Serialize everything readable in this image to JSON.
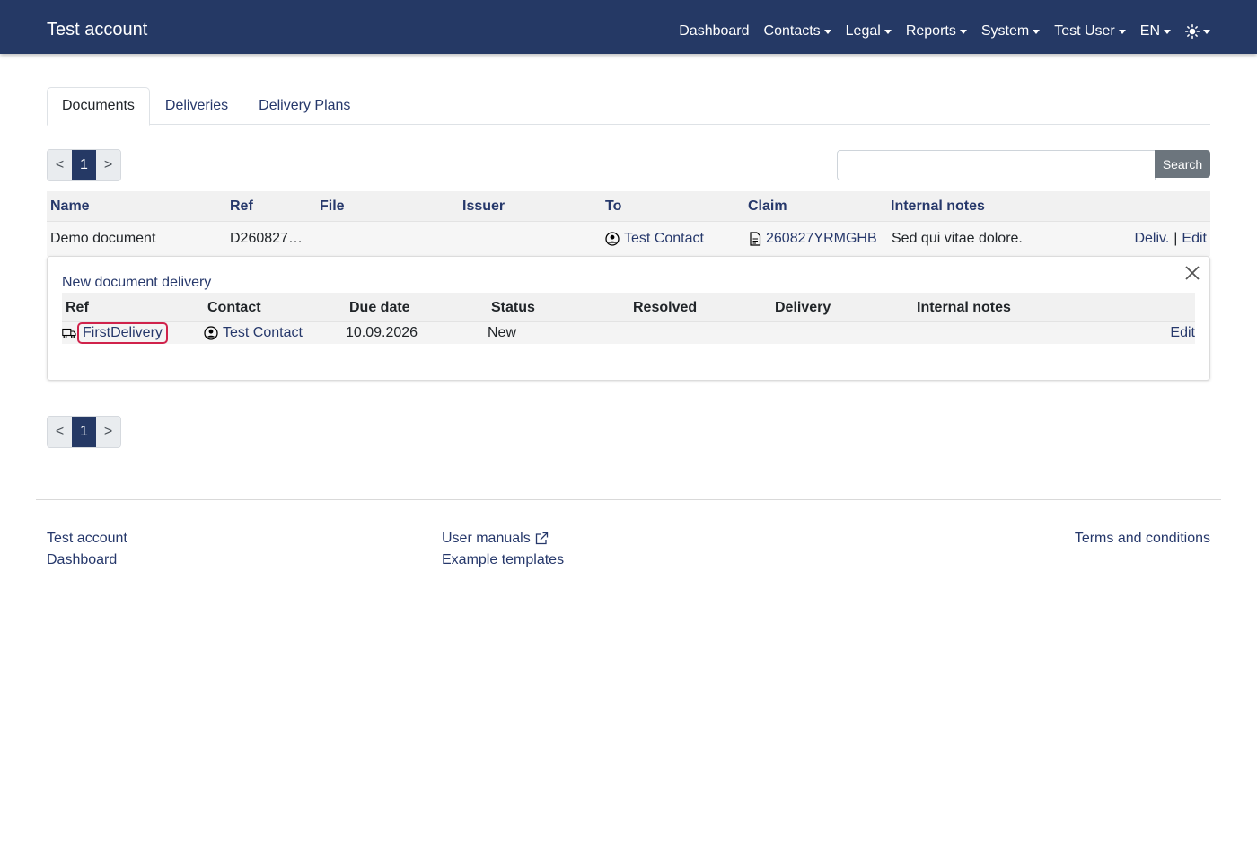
{
  "navbar": {
    "brand": "Test account",
    "items": [
      {
        "label": "Dashboard",
        "dropdown": false
      },
      {
        "label": "Contacts",
        "dropdown": true
      },
      {
        "label": "Legal",
        "dropdown": true
      },
      {
        "label": "Reports",
        "dropdown": true
      },
      {
        "label": "System",
        "dropdown": true
      },
      {
        "label": "Test User",
        "dropdown": true
      },
      {
        "label": "EN",
        "dropdown": true
      }
    ],
    "theme_icon": "sun-icon"
  },
  "tabs": [
    {
      "label": "Documents",
      "active": true
    },
    {
      "label": "Deliveries",
      "active": false
    },
    {
      "label": "Delivery Plans",
      "active": false
    }
  ],
  "pagination": {
    "prev": "<",
    "current": "1",
    "next": ">"
  },
  "search": {
    "placeholder": "",
    "value": "",
    "button": "Search"
  },
  "documents_table": {
    "columns": [
      "Name",
      "Ref",
      "File",
      "Issuer",
      "To",
      "Claim",
      "Internal notes"
    ],
    "rows": [
      {
        "name": "Demo document",
        "ref": "D260827…",
        "file": "",
        "issuer": "",
        "to": "Test Contact",
        "claim": "260827YRMGHB",
        "internal_notes": "Sed qui vitae dolore.",
        "action_deliv": "Deliv.",
        "action_sep": "|",
        "action_edit": "Edit"
      }
    ]
  },
  "delivery_panel": {
    "title": "New document delivery",
    "columns": [
      "Ref",
      "Contact",
      "Due date",
      "Status",
      "Resolved",
      "Delivery",
      "Internal notes"
    ],
    "rows": [
      {
        "ref": "FirstDelivery",
        "contact": "Test Contact",
        "due_date": "10.09.2026",
        "status": "New",
        "resolved": "",
        "delivery": "",
        "internal_notes": "",
        "action_edit": "Edit"
      }
    ]
  },
  "footer": {
    "col1": [
      "Test account",
      "Dashboard"
    ],
    "col2": [
      "User manuals",
      "Example templates"
    ],
    "col3": [
      "Terms and conditions"
    ]
  },
  "colors": {
    "navbar": "#253965",
    "link": "#26386b",
    "highlight": "#d0224b",
    "search_button": "#6c757d"
  }
}
